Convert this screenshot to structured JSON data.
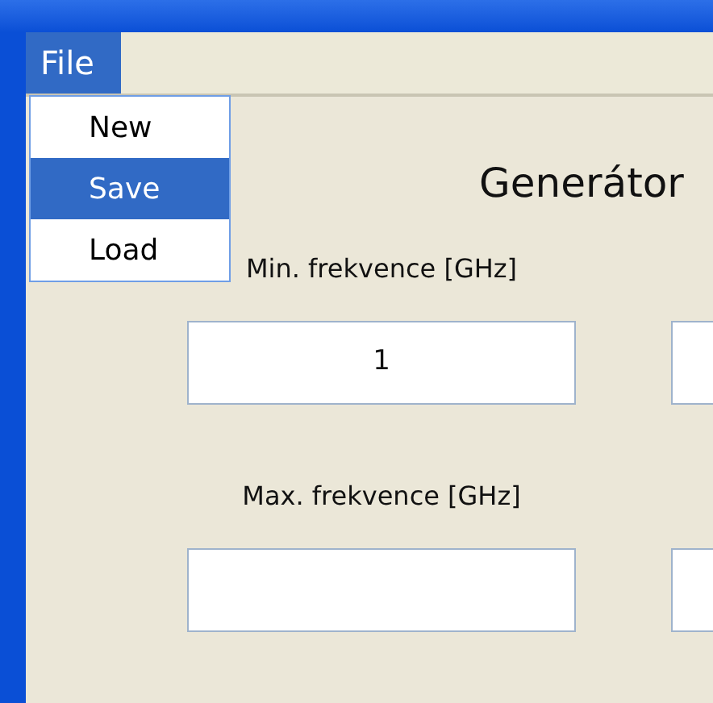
{
  "menu_bar": [
    {
      "label": "File",
      "selected": true
    }
  ],
  "file_menu": [
    {
      "label": "New",
      "selected": false
    },
    {
      "label": "Save",
      "selected": true
    },
    {
      "label": "Load",
      "selected": false
    }
  ],
  "title": "Generátor",
  "fields": [
    {
      "label": "Min. frekvence [GHz]",
      "value": "1"
    },
    {
      "label": "Max. frekvence [GHz]"
    }
  ]
}
